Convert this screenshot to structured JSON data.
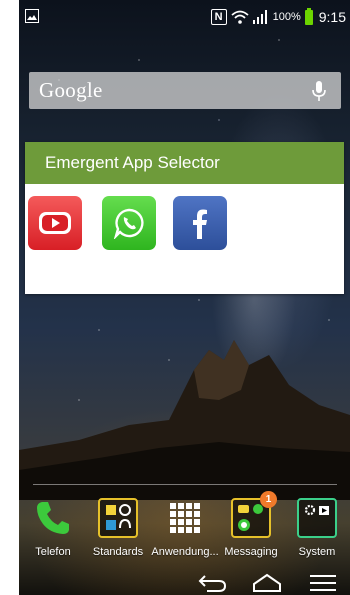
{
  "status_bar": {
    "nfc_label": "N",
    "battery_percent": "100%",
    "time": "9:15",
    "battery_color": "#6cd400"
  },
  "search": {
    "logo_text": "Google",
    "mic_icon": "microphone-icon"
  },
  "widget": {
    "title": "Emergent App Selector",
    "header_color": "#6e9b3a",
    "apps": [
      {
        "name": "youtube",
        "icon": "youtube-icon"
      },
      {
        "name": "whatsapp",
        "icon": "whatsapp-icon"
      },
      {
        "name": "facebook",
        "icon": "facebook-icon"
      }
    ]
  },
  "dock": {
    "items": [
      {
        "label": "Telefon",
        "icon": "phone-icon"
      },
      {
        "label": "Standards",
        "icon": "folder-icon"
      },
      {
        "label": "Anwendung...",
        "icon": "app-grid-icon"
      },
      {
        "label": "Messaging",
        "icon": "folder-icon",
        "badge": "1"
      },
      {
        "label": "System",
        "icon": "folder-icon"
      }
    ]
  },
  "nav_bar": {
    "buttons": [
      "back-icon",
      "home-icon",
      "menu-icon"
    ]
  }
}
